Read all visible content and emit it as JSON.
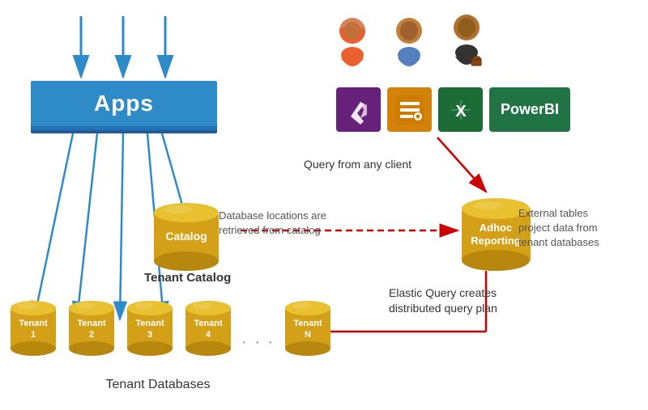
{
  "apps": {
    "label": "Apps"
  },
  "catalog": {
    "label": "Catalog",
    "name": "Catalog"
  },
  "adhoc": {
    "line1": "Adhoc",
    "line2": "Reporting"
  },
  "tenants": [
    {
      "line1": "Tenant",
      "line2": "1"
    },
    {
      "line1": "Tenant",
      "line2": "2"
    },
    {
      "line1": "Tenant",
      "line2": "3"
    },
    {
      "line1": "Tenant",
      "line2": "4"
    },
    {
      "line1": "Tenant",
      "line2": "N"
    }
  ],
  "labels": {
    "tenant_databases": "Tenant Databases",
    "tenant_catalog": "Tenant Catalog",
    "query_from_any_client": "Query from any client",
    "db_locations": "Database locations are\nretrieved from catalog",
    "external_tables": "External tables\nproject data from\ntenant databases",
    "elastic_query": "Elastic Query creates\ndistributed query plan"
  },
  "app_icons": [
    {
      "name": "visual-studio-icon",
      "label": "VS"
    },
    {
      "name": "tools-icon",
      "label": "⚙"
    },
    {
      "name": "excel-icon",
      "label": "X"
    }
  ],
  "powerbi": {
    "label": "PowerBI"
  }
}
